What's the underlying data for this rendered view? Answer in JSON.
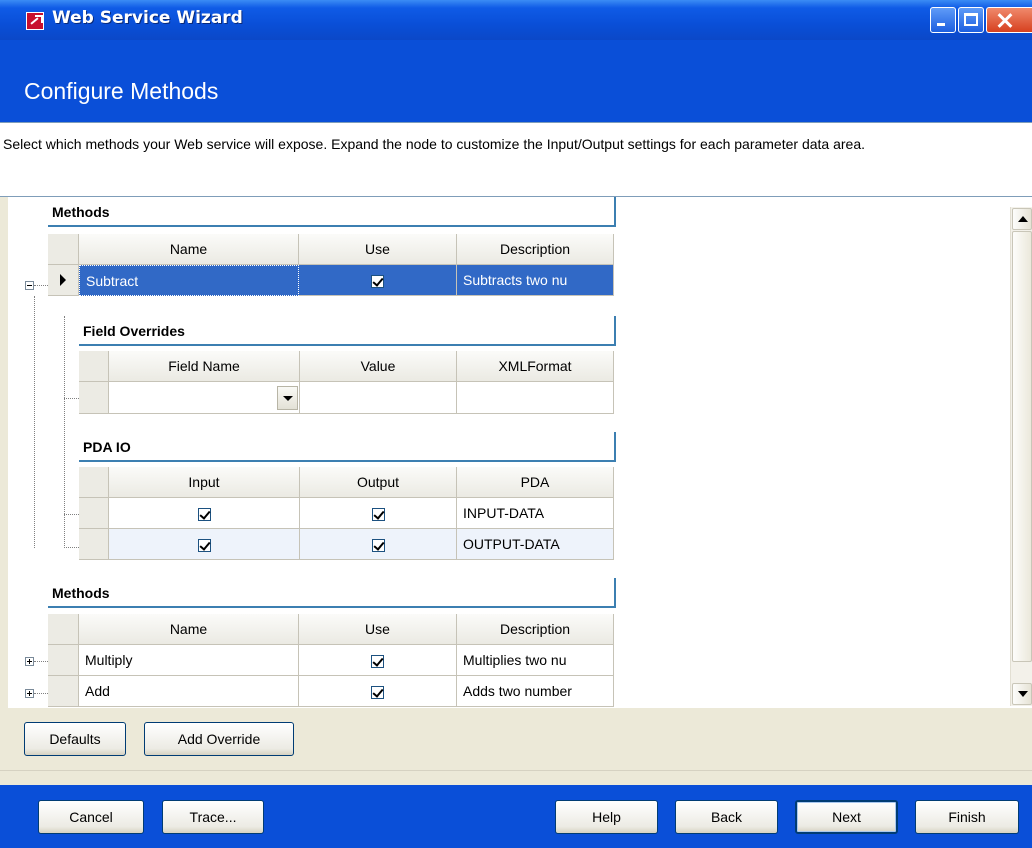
{
  "window": {
    "title": "Web Service Wizard"
  },
  "header": {
    "page_title": "Configure Methods"
  },
  "instructions": "Select which methods your Web service will expose. Expand the node to customize the Input/Output settings for each parameter data area.",
  "grid": {
    "methods_band_1": {
      "caption": "Methods",
      "columns": [
        "Name",
        "Use",
        "Description"
      ],
      "rows": [
        {
          "name": "Subtract",
          "use": true,
          "description": "Subtracts two nu",
          "expanded": true,
          "selected": true
        }
      ]
    },
    "field_overrides": {
      "caption": "Field Overrides",
      "columns": [
        "Field Name",
        "Value",
        "XMLFormat"
      ],
      "rows": [
        {
          "field_name": "",
          "value": "",
          "xml_format": ""
        }
      ]
    },
    "pda_io": {
      "caption": "PDA IO",
      "columns": [
        "Input",
        "Output",
        "PDA"
      ],
      "rows": [
        {
          "input": true,
          "output": true,
          "pda": "INPUT-DATA"
        },
        {
          "input": true,
          "output": true,
          "pda": "OUTPUT-DATA"
        }
      ]
    },
    "methods_band_2": {
      "caption": "Methods",
      "columns": [
        "Name",
        "Use",
        "Description"
      ],
      "rows": [
        {
          "name": "Multiply",
          "use": true,
          "description": "Multiplies two nu",
          "expanded": false
        },
        {
          "name": "Add",
          "use": true,
          "description": "Adds two number",
          "expanded": false
        }
      ]
    }
  },
  "actions": {
    "defaults": "Defaults",
    "add_override": "Add Override"
  },
  "footer": {
    "cancel": "Cancel",
    "trace": "Trace...",
    "help": "Help",
    "back": "Back",
    "next": "Next",
    "finish": "Finish"
  },
  "colors": {
    "titlebar": "#0a4fd8",
    "selection": "#3169c6",
    "band_border": "#3c7fb1",
    "dialog_bg": "#ece9d8"
  }
}
